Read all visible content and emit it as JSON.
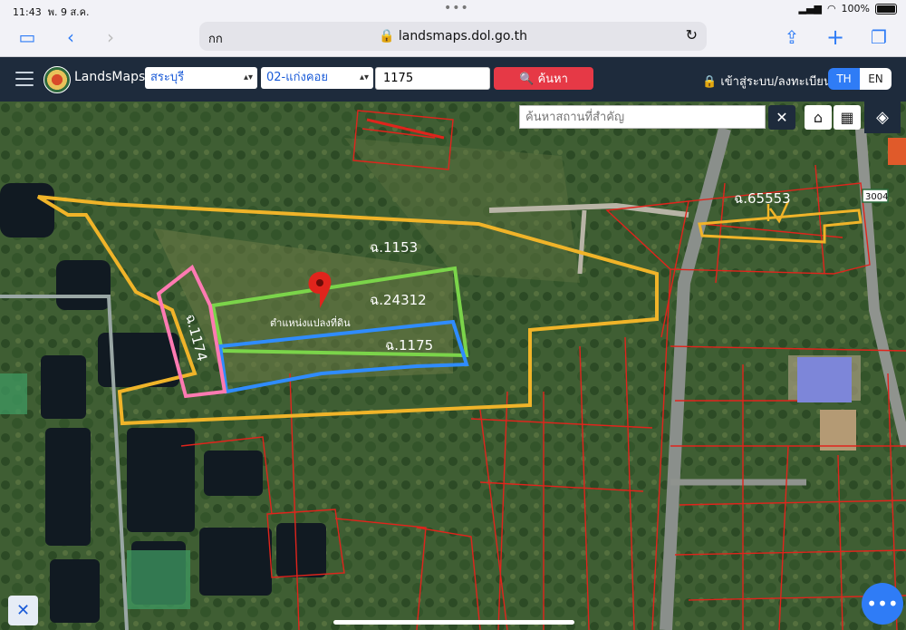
{
  "status": {
    "time": "11:43",
    "date": "พ. 9 ส.ค.",
    "battery": "100%"
  },
  "browser": {
    "aa": "กก",
    "url": "landsmaps.dol.go.th"
  },
  "app": {
    "brand": "LandsMaps",
    "province": "สระบุรี",
    "district": "02-แก่งคอย",
    "parcel_no": "1175",
    "search_label": "ค้นหา",
    "login_label": "เข้าสู่ระบบ/ลงทะเบียน",
    "lang_th": "TH",
    "lang_en": "EN"
  },
  "map": {
    "poi_placeholder": "ค้นหาสถานที่สำคัญ",
    "road_badge": "3004",
    "parcels": [
      {
        "label": "ฉ.1153",
        "color": "#f0b429"
      },
      {
        "label": "ฉ.24312",
        "color": "#7bd44a"
      },
      {
        "label": "ฉ.1175",
        "color": "#2f8cff"
      },
      {
        "label": "ฉ.1174",
        "color": "#ff7ab2"
      },
      {
        "label": "ฉ.65553",
        "color": "#f0b429"
      }
    ],
    "marker_caption": "ตำแหน่งแปลงที่ดิน",
    "boundary_color": "#e0241c"
  },
  "icons": {
    "menu": "hamburger-icon",
    "lock": "lock-icon",
    "home": "home-icon",
    "grid": "grid-icon",
    "layers": "layers-icon",
    "tools": "tools-icon",
    "more": "more-icon"
  }
}
